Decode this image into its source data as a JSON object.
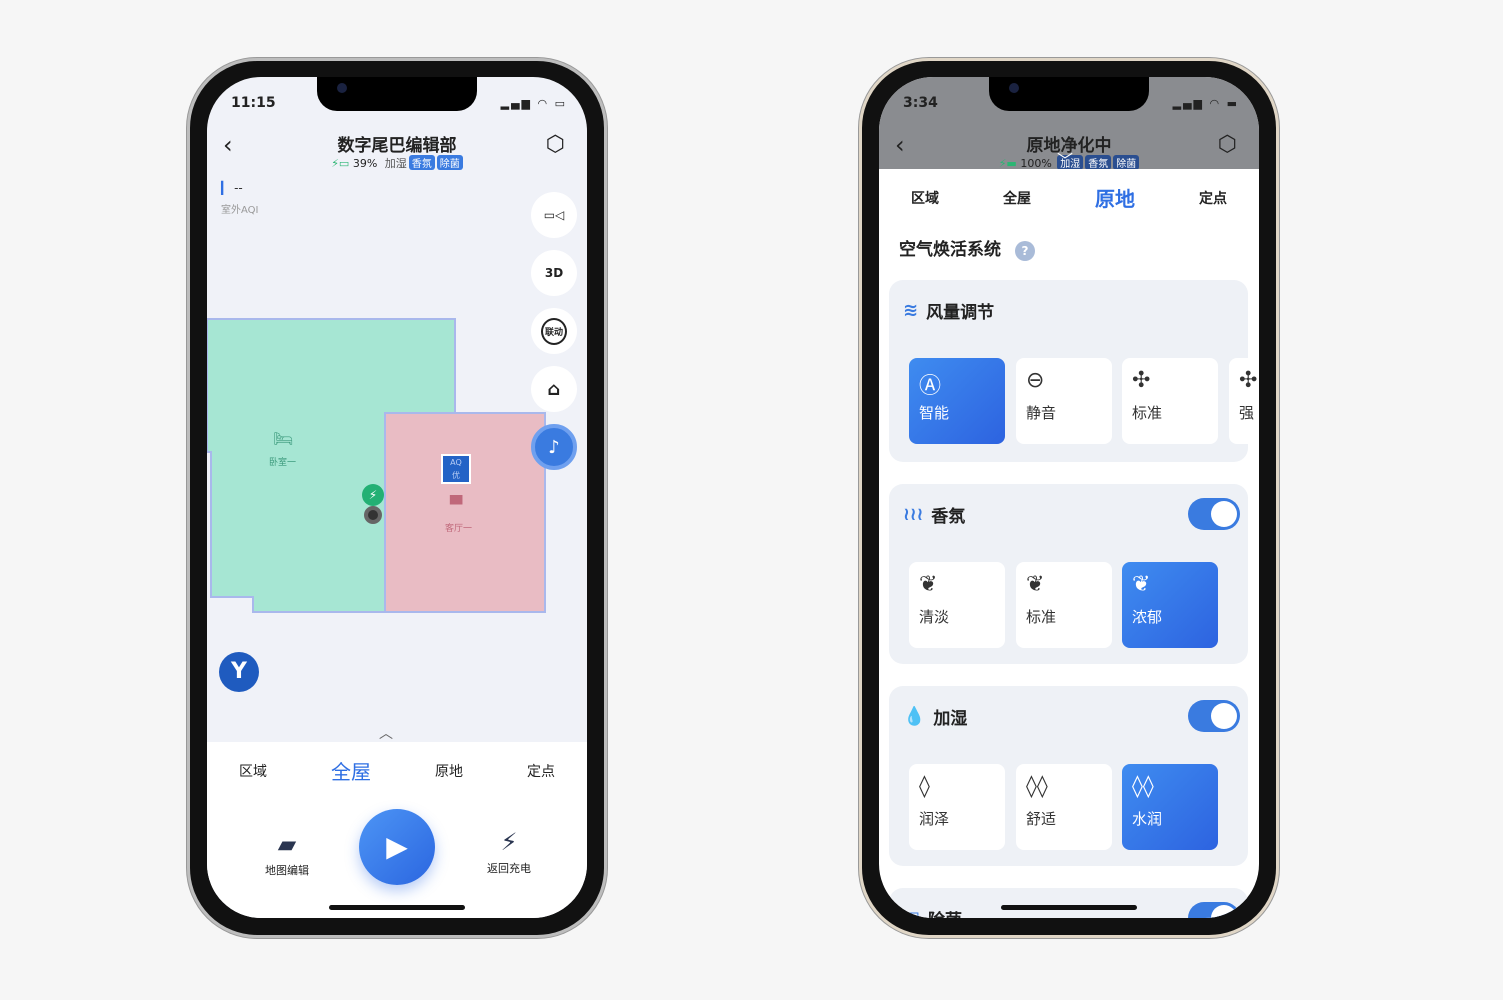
{
  "left": {
    "status": {
      "time": "11:15"
    },
    "header": {
      "title": "数字尾巴编辑部",
      "battery": "39%",
      "tags": [
        "加湿",
        "香氛",
        "除菌"
      ]
    },
    "aqi": {
      "value": "--",
      "label": "室外AQI"
    },
    "side_buttons": [
      {
        "icon": "camera-icon"
      },
      {
        "label": "3D"
      },
      {
        "label": "联动"
      },
      {
        "icon": "home-icon"
      },
      {
        "icon": "music-icon"
      }
    ],
    "map": {
      "rooms": [
        {
          "name": "卧室一",
          "color": "#a6e6d3"
        },
        {
          "name": "客厅一",
          "color": "#e9bcc4"
        }
      ],
      "aq_badge": {
        "line1": "AQ",
        "line2": "优"
      }
    },
    "tabs": [
      "区域",
      "全屋",
      "原地",
      "定点"
    ],
    "active_tab": "全屋",
    "actions": {
      "map_edit": "地图编辑",
      "recharge": "返回充电"
    }
  },
  "right": {
    "status": {
      "time": "3:34"
    },
    "header": {
      "title": "原地净化中",
      "battery": "100%",
      "tags": [
        "加湿",
        "香氛",
        "除菌"
      ]
    },
    "tabs": [
      "区域",
      "全屋",
      "原地",
      "定点"
    ],
    "active_tab": "原地",
    "section_title": "空气焕活系统",
    "cards": [
      {
        "title": "风量调节",
        "options": [
          "智能",
          "静音",
          "标准",
          "强"
        ],
        "selected": "智能"
      },
      {
        "title": "香氛",
        "toggle": true,
        "options": [
          "清淡",
          "标准",
          "浓郁"
        ],
        "selected": "浓郁"
      },
      {
        "title": "加湿",
        "toggle": true,
        "options": [
          "润泽",
          "舒适",
          "水润"
        ],
        "selected": "水润"
      },
      {
        "title": "除菌",
        "toggle": true
      }
    ]
  },
  "colors": {
    "accent": "#3a7be0"
  }
}
